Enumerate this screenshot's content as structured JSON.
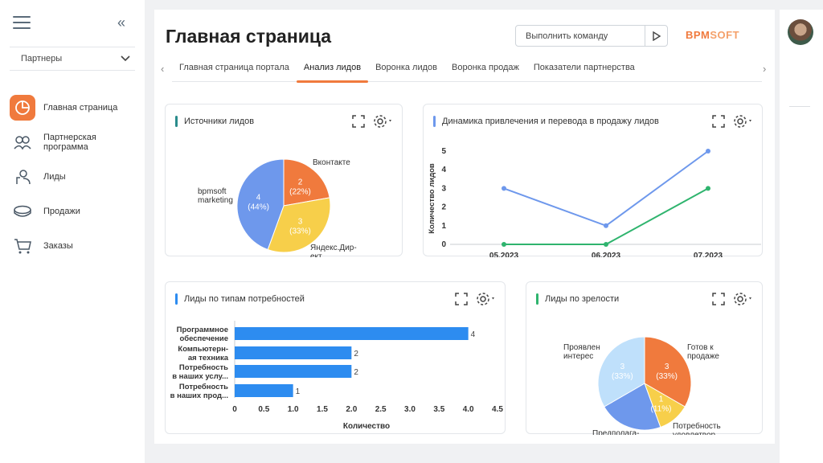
{
  "sidebar": {
    "workspace": "Партнеры",
    "items": [
      {
        "label": "Главная страница",
        "icon": "dashboard-icon",
        "active": true
      },
      {
        "label": "Партнерская программа",
        "icon": "partners-icon",
        "active": false
      },
      {
        "label": "Лиды",
        "icon": "leads-icon",
        "active": false
      },
      {
        "label": "Продажи",
        "icon": "sales-icon",
        "active": false
      },
      {
        "label": "Заказы",
        "icon": "cart-icon",
        "active": false
      }
    ]
  },
  "header": {
    "title": "Главная страница",
    "command_placeholder": "Выполнить команду",
    "logo_part1": "BPM",
    "logo_part2": "SOFT"
  },
  "tabs": [
    {
      "label": "Главная страница портала",
      "active": false
    },
    {
      "label": "Анализ лидов",
      "active": true
    },
    {
      "label": "Воронка лидов",
      "active": false
    },
    {
      "label": "Воронка продаж",
      "active": false
    },
    {
      "label": "Показатели партнерства",
      "active": false
    }
  ],
  "colors": {
    "accent": "#f07a3d",
    "blue": "#6e98ec",
    "green": "#2fb46e",
    "bar_blue": "#2d8cf0"
  },
  "widgets": {
    "sources": {
      "title": "Источники лидов",
      "accent": "#2a8c8c"
    },
    "dynamics": {
      "title": "Динамика привлечения и перевода в продажу лидов",
      "accent": "#6e98ec"
    },
    "needs": {
      "title": "Лиды по типам потребностей",
      "accent": "#2d8cf0"
    },
    "maturity": {
      "title": "Лиды по зрелости",
      "accent": "#2fb46e"
    }
  },
  "chart_data": [
    {
      "type": "pie",
      "slices": [
        {
          "label": "Вконтакте",
          "value": 2,
          "pct": "22%",
          "color": "#f07a3d"
        },
        {
          "label": "Яндекс.Дир-ект",
          "value": 3,
          "pct": "33%",
          "color": "#f7cf4a"
        },
        {
          "label": "bpmsoft marketing",
          "value": 4,
          "pct": "44%",
          "color": "#6e98ec"
        }
      ]
    },
    {
      "type": "line",
      "categories": [
        "05.2023",
        "06.2023",
        "07.2023"
      ],
      "ylabel": "Количество лидов",
      "ylim": [
        0,
        5
      ],
      "yticks": [
        "0",
        "1",
        "2",
        "3",
        "4",
        "5"
      ],
      "series": [
        {
          "values": [
            3,
            1,
            5
          ],
          "color": "#6e98ec"
        },
        {
          "values": [
            0,
            0,
            3
          ],
          "color": "#2fb46e"
        }
      ]
    },
    {
      "type": "bar",
      "orientation": "horizontal",
      "categories": [
        [
          "Программное",
          "обеспечение"
        ],
        [
          "Компьютерн-",
          "ая техника"
        ],
        [
          "Потребность",
          "в наших услу..."
        ],
        [
          "Потребность",
          "в наших прод..."
        ]
      ],
      "values": [
        4,
        2,
        2,
        1
      ],
      "value_labels": [
        "4",
        "2",
        "2",
        "1"
      ],
      "xlabel": "Количество",
      "xlim": [
        0,
        4.5
      ],
      "xticks": [
        "0",
        "0.5",
        "1.0",
        "1.5",
        "2.0",
        "2.5",
        "3.0",
        "3.5",
        "4.0",
        "4.5"
      ]
    },
    {
      "type": "pie",
      "slices": [
        {
          "label": "Готов к продаже",
          "value": 3,
          "pct": "33%",
          "color": "#f07a3d"
        },
        {
          "label": "Потребность удовлетвор...",
          "value": 1,
          "pct": "11%",
          "color": "#f7cf4a"
        },
        {
          "label": "Предполага-ется интерес",
          "value": 2,
          "pct": "",
          "color": "#6e98ec"
        },
        {
          "label": "Проявлен интерес",
          "value": 3,
          "pct": "33%",
          "color": "#bfe0fb"
        }
      ]
    }
  ]
}
